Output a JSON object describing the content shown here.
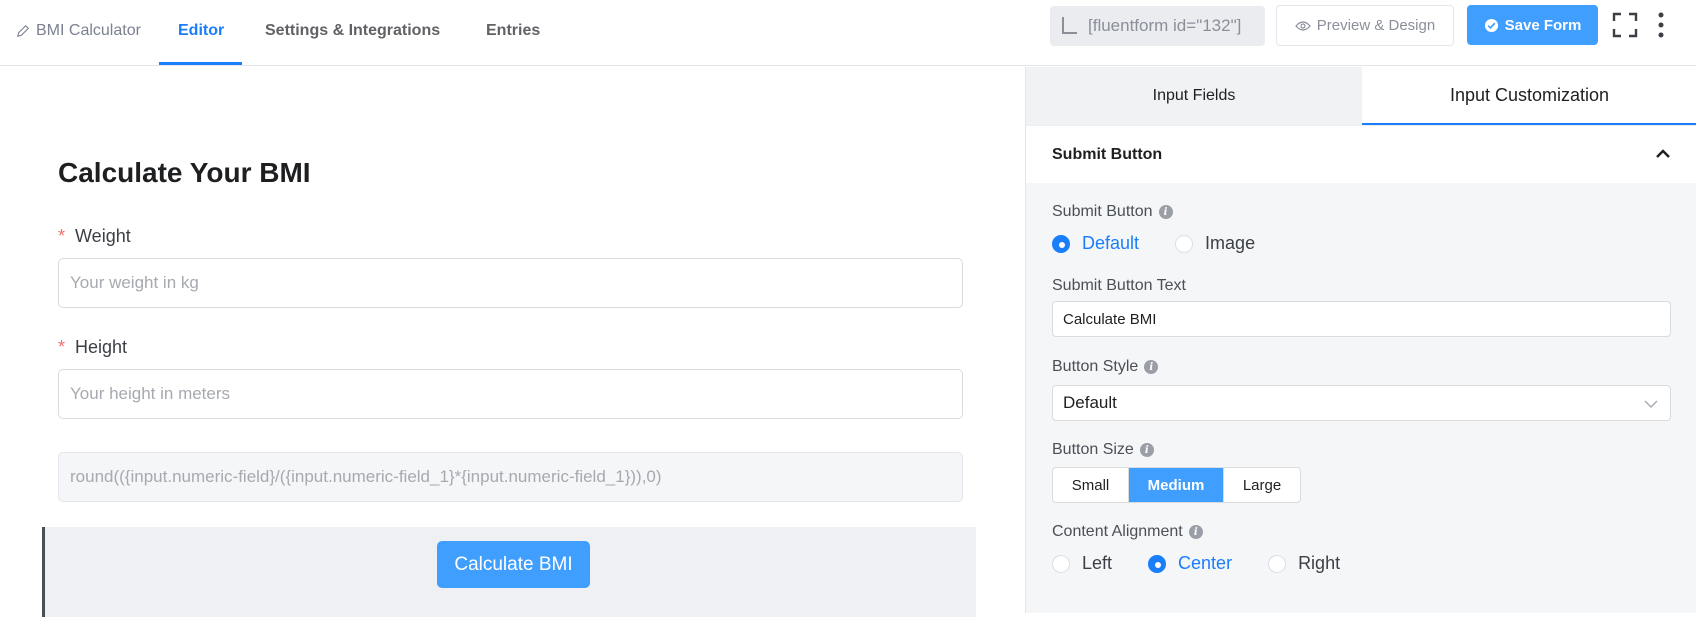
{
  "header": {
    "breadcrumb": "BMI Calculator",
    "tabs": [
      "Editor",
      "Settings & Integrations",
      "Entries"
    ],
    "active_tab": "Editor",
    "shortcode": "[fluentform id=\"132\"]",
    "preview_label": "Preview & Design",
    "save_label": "Save Form"
  },
  "form": {
    "title": "Calculate Your BMI",
    "weight": {
      "label": "Weight",
      "required_mark": "*",
      "placeholder": "Your weight in kg"
    },
    "height": {
      "label": "Height",
      "required_mark": "*",
      "placeholder": "Your height in meters"
    },
    "formula": "round(({input.numeric-field}/({input.numeric-field_1}*{input.numeric-field_1})),0)",
    "submit_label": "Calculate BMI"
  },
  "panel": {
    "tabs": [
      "Input Fields",
      "Input Customization"
    ],
    "active_tab": "Input Customization",
    "section_title": "Submit Button",
    "submit_button": {
      "label": "Submit Button",
      "options": [
        "Default",
        "Image"
      ],
      "selected": "Default"
    },
    "submit_text": {
      "label": "Submit Button Text",
      "value": "Calculate BMI"
    },
    "button_style": {
      "label": "Button Style",
      "value": "Default"
    },
    "button_size": {
      "label": "Button Size",
      "options": [
        "Small",
        "Medium",
        "Large"
      ],
      "selected": "Medium"
    },
    "alignment": {
      "label": "Content Alignment",
      "options": [
        "Left",
        "Center",
        "Right"
      ],
      "selected": "Center"
    }
  },
  "colors": {
    "accent": "#409eff",
    "active_text": "#1a7efb",
    "required": "#f56c6c"
  },
  "icons": [
    "pencil-icon",
    "corner-icon",
    "eye-icon",
    "check-circle-icon",
    "fullscreen-icon",
    "more-vertical-icon",
    "chevron-up-icon",
    "chevron-down-icon",
    "info-icon"
  ]
}
